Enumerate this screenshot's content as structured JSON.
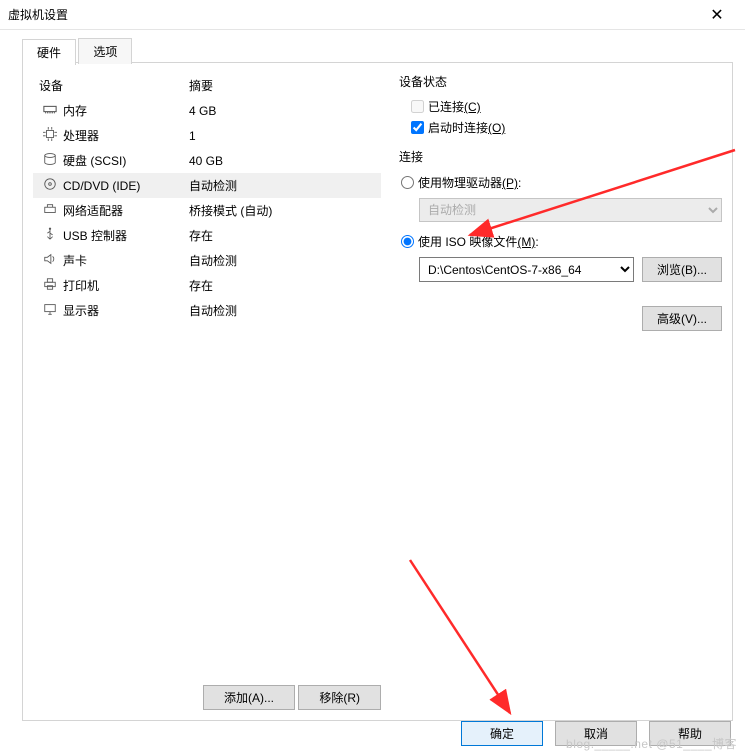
{
  "window": {
    "title": "虚拟机设置",
    "close": "✕"
  },
  "tabs": {
    "hardware": "硬件",
    "options": "选项"
  },
  "headers": {
    "device": "设备",
    "summary": "摘要"
  },
  "devices": [
    {
      "icon": "memory",
      "name": "内存",
      "summary": "4 GB"
    },
    {
      "icon": "cpu",
      "name": "处理器",
      "summary": "1"
    },
    {
      "icon": "disk",
      "name": "硬盘 (SCSI)",
      "summary": "40 GB"
    },
    {
      "icon": "cd",
      "name": "CD/DVD (IDE)",
      "summary": "自动检测"
    },
    {
      "icon": "net",
      "name": "网络适配器",
      "summary": "桥接模式 (自动)"
    },
    {
      "icon": "usb",
      "name": "USB 控制器",
      "summary": "存在"
    },
    {
      "icon": "sound",
      "name": "声卡",
      "summary": "自动检测"
    },
    {
      "icon": "printer",
      "name": "打印机",
      "summary": "存在"
    },
    {
      "icon": "display",
      "name": "显示器",
      "summary": "自动检测"
    }
  ],
  "buttons": {
    "add": "添加(A)...",
    "remove": "移除(R)",
    "browse": "浏览(B)...",
    "advanced": "高级(V)...",
    "ok": "确定",
    "cancel": "取消",
    "help": "帮助"
  },
  "status": {
    "title": "设备状态",
    "connected": "已连接",
    "connectedKey": "(C)",
    "connectOnStart": "启动时连接",
    "connectOnStartKey": "(O)"
  },
  "connection": {
    "title": "连接",
    "physical": "使用物理驱动器",
    "physicalKey": "(P)",
    "autodetect": "自动检测",
    "iso": "使用 ISO 映像文件",
    "isoKey": "(M)",
    "isoPath": "D:\\Centos\\CentOS-7-x86_64"
  },
  "watermark": "blog._____.net @51____博客"
}
